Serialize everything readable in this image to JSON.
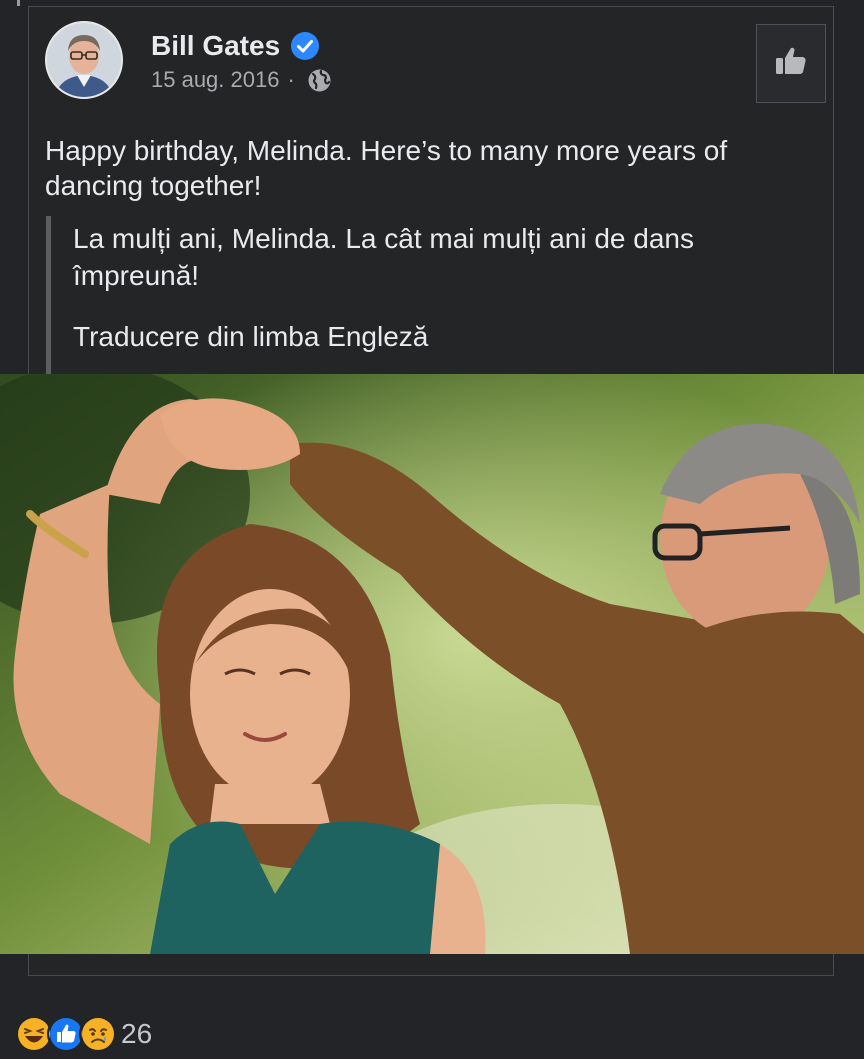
{
  "post": {
    "author": "Bill Gates",
    "date": "15 aug. 2016",
    "separator": "·",
    "text": "Happy birthday, Melinda. Here’s to many more years of dancing together!",
    "translation": "La mulți ani, Melinda. La cât mai mulți ani de dans împreună!",
    "translation_source": "Traducere din limba Engleză"
  },
  "reactions": {
    "types": [
      "laugh-icon",
      "like-icon",
      "sad-icon"
    ],
    "count": "26"
  },
  "icons": {
    "verified": "verified-badge-icon",
    "privacy": "globe-icon",
    "like": "thumbs-up-icon"
  },
  "colors": {
    "background": "#232427",
    "verified": "#2d88ff",
    "like_blue": "#1877f2",
    "reaction_yellow": "#f7b125"
  }
}
